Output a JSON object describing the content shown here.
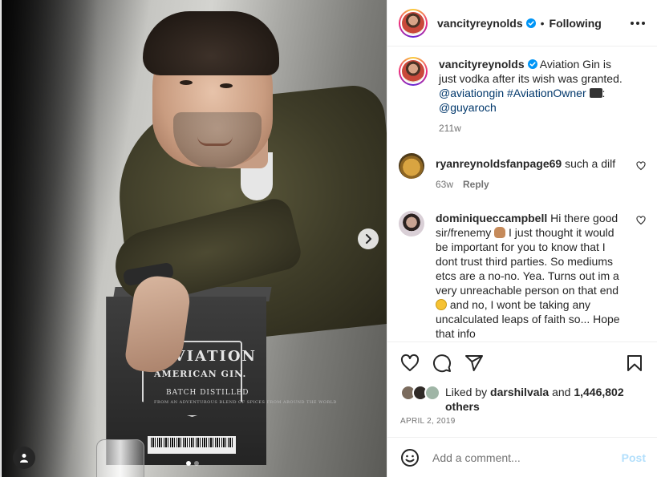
{
  "post": {
    "author": "vancityreynolds",
    "follow_status": "Following",
    "separator": "•",
    "caption": {
      "text": "Aviation Gin is just vodka after its wish was granted.",
      "mention_1": "@aviationgin",
      "hashtag": "#AviationOwner",
      "camera_suffix": ":",
      "mention_2": "@guyaroch",
      "time": "211w"
    },
    "comments": [
      {
        "user": "ryanreynoldsfanpage69",
        "text": "such a dilf",
        "time": "63w",
        "reply": "Reply"
      },
      {
        "user": "dominiqueccampbell",
        "text_1": "Hi there good sir/frenemy",
        "text_2": "I just thought it would be important for you to know that I dont trust third parties. So mediums etcs are a no-no. Yea. Turns out im a very unreachable person on that end",
        "text_3": "and no, I wont be taking any uncalculated leaps of faith so... Hope that info"
      }
    ],
    "likes": {
      "prefix": "Liked by",
      "liker": "darshilvala",
      "and": "and",
      "count": "1,446,802",
      "suffix": "others"
    },
    "date": "APRIL 2, 2019",
    "add_comment": {
      "placeholder": "Add a comment...",
      "post_label": "Post"
    },
    "photo": {
      "brand_line_1": "AVIATION",
      "brand_line_2": "AMERICAN GIN.",
      "brand_line_3": "BATCH DISTILLED",
      "brand_line_4": "FROM AN ADVENTUROUS BLEND OF SPICES FROM AROUND THE WORLD",
      "carousel_total": 2,
      "carousel_index": 1
    }
  },
  "icons": {
    "verified": "verified-badge-icon",
    "more": "more-options-icon",
    "like": "heart-icon",
    "comment": "comment-bubble-icon",
    "share": "paper-plane-icon",
    "save": "bookmark-icon",
    "emoji": "smiley-icon",
    "next": "chevron-right-icon",
    "tags": "user-tag-icon"
  },
  "colors": {
    "accent": "#0095f6",
    "link": "#00376b",
    "verified": "#0095f6",
    "post_disabled": "#b2dffc",
    "text": "#262626",
    "muted": "#737373"
  }
}
